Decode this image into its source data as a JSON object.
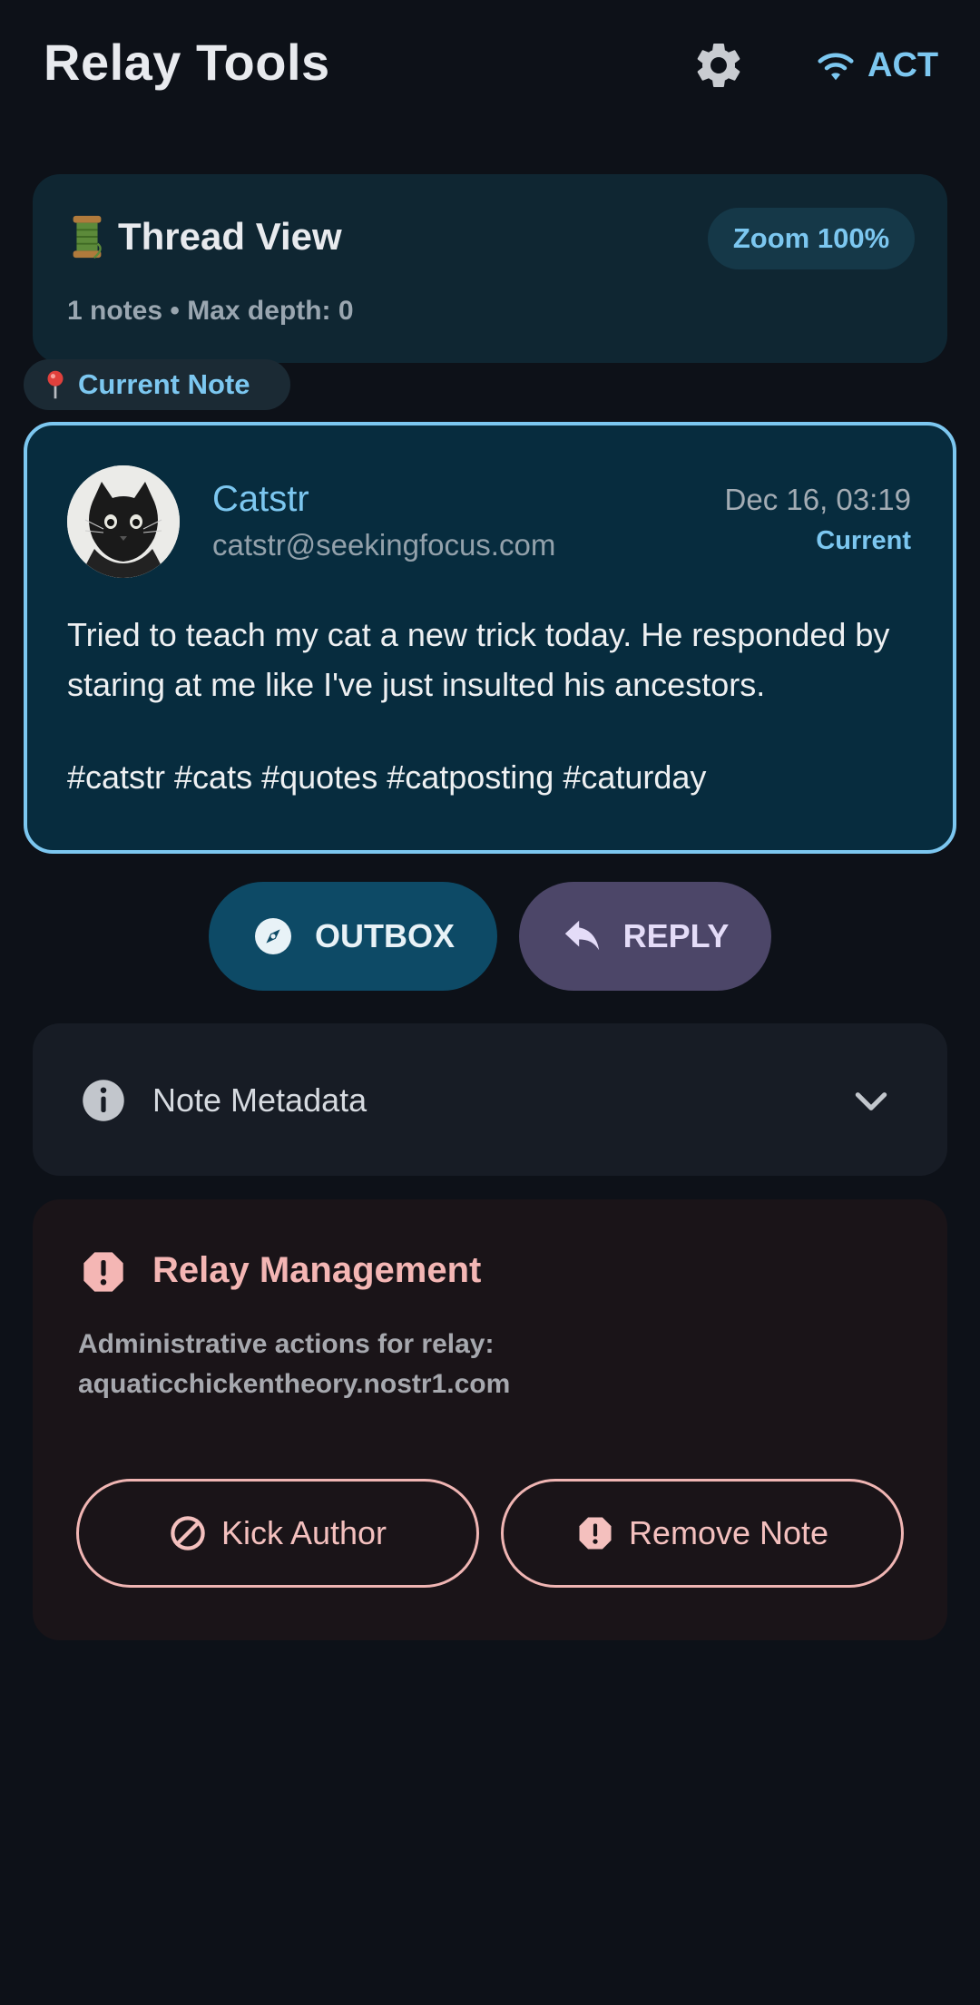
{
  "header": {
    "title": "Relay Tools",
    "settings_icon": "gear-icon",
    "connection_label": "ACT",
    "connection_icon": "wifi-icon"
  },
  "thread": {
    "icon": "spool-of-thread-icon",
    "title": "Thread View",
    "zoom_label": "Zoom 100%",
    "subtitle": "1 notes • Max depth: 0"
  },
  "current_chip": {
    "icon": "pin-icon",
    "label": "Current Note"
  },
  "note": {
    "author_name": "Catstr",
    "author_nip05": "catstr@seekingfocus.com",
    "date": "Dec 16, 03:19",
    "status": "Current",
    "body": "Tried to teach my cat a new trick today. He responded by staring at me like I've just insulted his ancestors.",
    "hashtags": "#catstr #cats #quotes #catposting #caturday"
  },
  "actions": {
    "outbox_label": "OUTBOX",
    "reply_label": "REPLY"
  },
  "metadata": {
    "label": "Note Metadata"
  },
  "relay_management": {
    "title": "Relay Management",
    "description_line1": "Administrative actions for relay:",
    "description_line2": "aquaticchickentheory.nostr1.com",
    "kick_label": "Kick Author",
    "remove_label": "Remove Note"
  },
  "colors": {
    "background": "#0d1118",
    "accent": "#7cc7f0",
    "danger": "#f4b6b4",
    "note_border": "#7cc7f0"
  }
}
